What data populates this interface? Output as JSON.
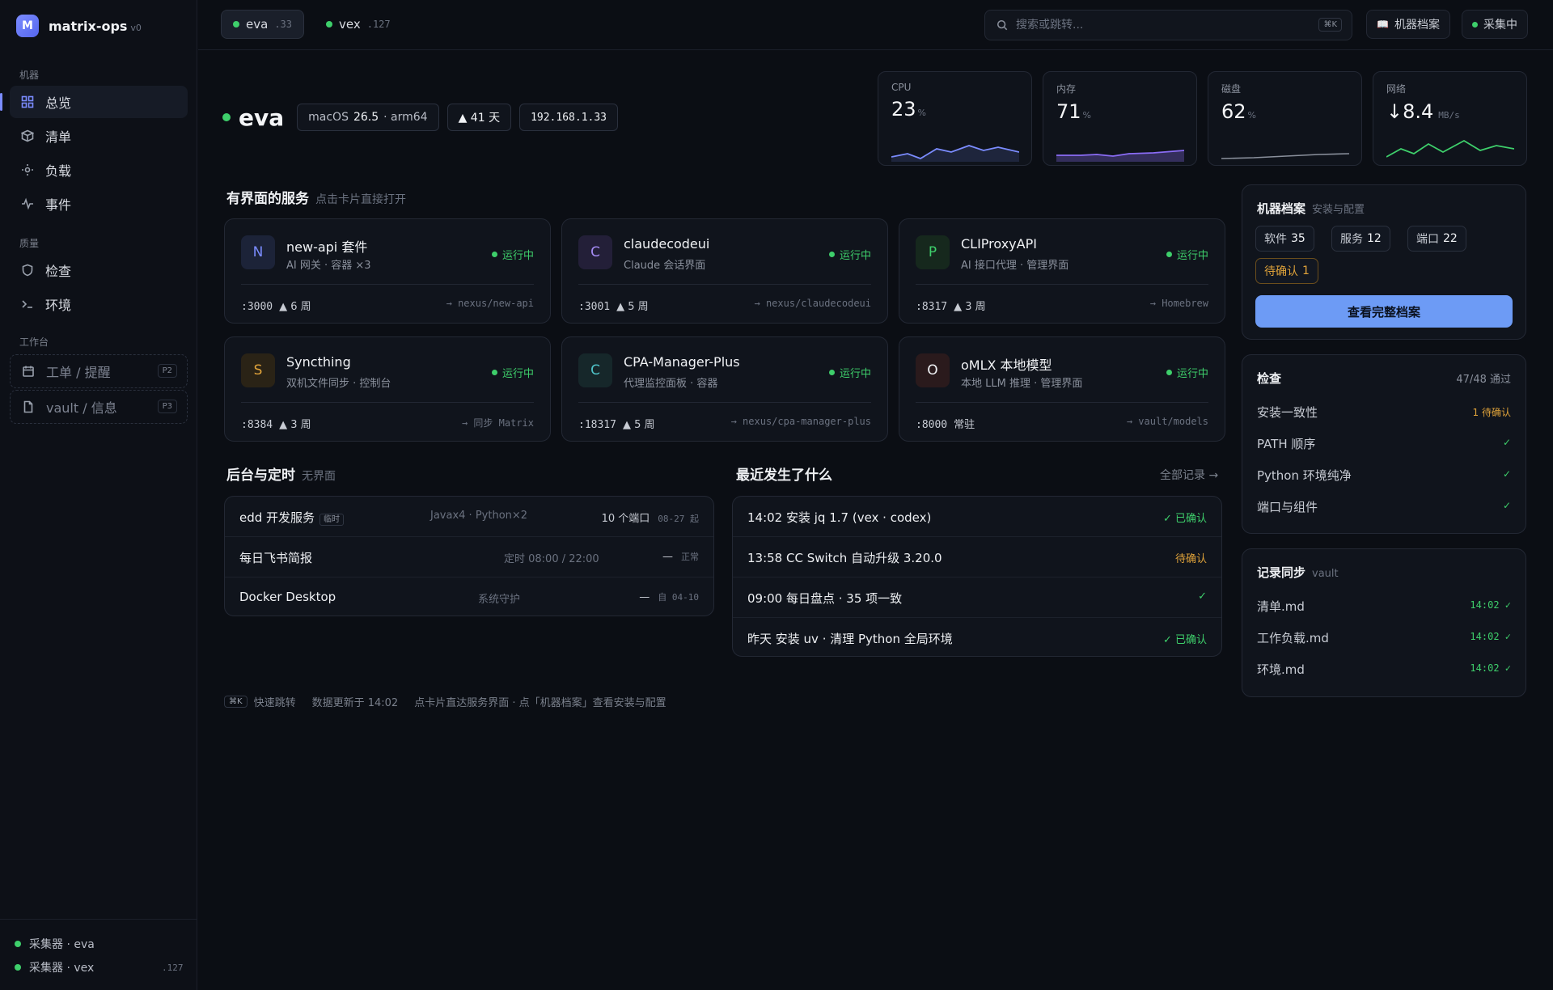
{
  "brand": {
    "name": "matrix-ops",
    "version": "v0",
    "logo": "M"
  },
  "sidebar": {
    "sections": [
      "机器",
      "质量",
      "工作台"
    ],
    "items": [
      {
        "label": "总览",
        "icon": "grid-icon"
      },
      {
        "label": "清单",
        "icon": "box-icon"
      },
      {
        "label": "负载",
        "icon": "sun-icon"
      },
      {
        "label": "事件",
        "icon": "pulse-icon"
      },
      {
        "label": "检查",
        "icon": "shield-icon"
      },
      {
        "label": "环境",
        "icon": "terminal-icon"
      }
    ],
    "workbench": [
      {
        "label": "工单 / 提醒",
        "badge": "P2"
      },
      {
        "label": "vault / 信息",
        "badge": "P3"
      }
    ],
    "collectors": [
      {
        "label": "采集器 · eva",
        "ip": ""
      },
      {
        "label": "采集器 · vex",
        "ip": ".127"
      }
    ]
  },
  "topbar": {
    "hosts": [
      {
        "name": "eva",
        "num": ".33"
      },
      {
        "name": "vex",
        "num": ".127"
      }
    ],
    "search_placeholder": "搜索或跳转...",
    "search_kbd": "⌘K",
    "profile_btn": "机器档案",
    "collect_btn": "采集中"
  },
  "host": {
    "name": "eva",
    "os": "macOS",
    "os_version": "26.5",
    "arch": "· arm64",
    "uptime": "▲ 41 天",
    "ip": "192.168.1.33"
  },
  "metrics": [
    {
      "label": "CPU",
      "value": "23",
      "unit": "%",
      "color": "#7b8cff"
    },
    {
      "label": "内存",
      "value": "71",
      "unit": "%",
      "color": "#8a6cf5"
    },
    {
      "label": "磁盘",
      "value": "62",
      "unit": "%",
      "color": "#9aa1ad"
    },
    {
      "label": "网络",
      "value": "↓8.4",
      "unit": "MB/s",
      "color": "#3ecf6b"
    }
  ],
  "services_section": {
    "title": "有界面的服务",
    "subtitle": "点击卡片直接打开"
  },
  "services": [
    {
      "initial": "N",
      "name": "new-api 套件",
      "desc": "AI 网关 · 容器 ×3",
      "status": "运行中",
      "port": ":3000",
      "age": "▲ 6 周",
      "path": "→ nexus/new-api",
      "color": "#7b8cff",
      "bg": "#1c2338"
    },
    {
      "initial": "C",
      "name": "claudecodeui",
      "desc": "Claude 会话界面",
      "status": "运行中",
      "port": ":3001",
      "age": "▲ 5 周",
      "path": "→ nexus/claudecodeui",
      "color": "#a58cf5",
      "bg": "#231f38"
    },
    {
      "initial": "P",
      "name": "CLIProxyAPI",
      "desc": "AI 接口代理 · 管理界面",
      "status": "运行中",
      "port": ":8317",
      "age": "▲ 3 周",
      "path": "→ Homebrew",
      "color": "#3ecf6b",
      "bg": "#16281d"
    },
    {
      "initial": "S",
      "name": "Syncthing",
      "desc": "双机文件同步 · 控制台",
      "status": "运行中",
      "port": ":8384",
      "age": "▲ 3 周",
      "path": "→ 同步 Matrix",
      "color": "#e0a33a",
      "bg": "#2a2316"
    },
    {
      "initial": "C",
      "name": "CPA-Manager-Plus",
      "desc": "代理监控面板 · 容器",
      "status": "运行中",
      "port": ":18317",
      "age": "▲ 5 周",
      "path": "→ nexus/cpa-manager-plus",
      "color": "#4fc3c8",
      "bg": "#16272a"
    },
    {
      "initial": "O",
      "name": "oMLX 本地模型",
      "desc": "本地 LLM 推理 · 管理界面",
      "status": "运行中",
      "port": ":8000",
      "age": "常驻",
      "path": "→ vault/models",
      "color": "#f0f2f5",
      "bg": "#2a1a1c"
    }
  ],
  "background": {
    "title": "后台与定时",
    "subtitle": "无界面",
    "rows": [
      {
        "name": "edd 开发服务",
        "tag": "临时",
        "meta": "Javax4 · Python×2",
        "right": "10 个端口",
        "right_sub": "08-27 起"
      },
      {
        "name": "每日飞书简报",
        "tag": "",
        "meta": "定时 08:00 / 22:00",
        "right": "—",
        "right_sub": "正常"
      },
      {
        "name": "Docker Desktop",
        "tag": "",
        "meta": "系统守护",
        "right": "—",
        "right_sub": "自 04-10"
      }
    ]
  },
  "events": {
    "title": "最近发生了什么",
    "all_link": "全部记录 →",
    "rows": [
      {
        "text": "14:02 安装 jq 1.7 (vex · codex)",
        "status": "✓ 已确认",
        "warn": false
      },
      {
        "text": "13:58 CC Switch 自动升级 3.20.0",
        "status": "待确认",
        "warn": true
      },
      {
        "text": "09:00 每日盘点 · 35 项一致",
        "status": "✓",
        "warn": false
      },
      {
        "text": "昨天 安装 uv · 清理 Python 全局环境",
        "status": "✓ 已确认",
        "warn": false
      }
    ]
  },
  "profile": {
    "title": "机器档案",
    "subtitle": "安装与配置",
    "chips": [
      {
        "label": "软件",
        "value": "35"
      },
      {
        "label": "服务",
        "value": "12"
      },
      {
        "label": "端口",
        "value": "22"
      }
    ],
    "pending": {
      "label": "待确认",
      "value": "1"
    },
    "button": "查看完整档案"
  },
  "checks": {
    "title": "检查",
    "summary": "47/48 通过",
    "rows": [
      {
        "label": "安装一致性",
        "value": "1 待确认",
        "warn": true
      },
      {
        "label": "PATH 顺序",
        "value": "✓",
        "warn": false
      },
      {
        "label": "Python 环境纯净",
        "value": "✓",
        "warn": false
      },
      {
        "label": "端口与组件",
        "value": "✓",
        "warn": false
      }
    ]
  },
  "sync": {
    "title": "记录同步",
    "subtitle": "vault",
    "rows": [
      {
        "label": "清单.md",
        "value": "14:02 ✓"
      },
      {
        "label": "工作负载.md",
        "value": "14:02 ✓"
      },
      {
        "label": "环境.md",
        "value": "14:02 ✓"
      }
    ]
  },
  "footer": {
    "kbd": "⌘K",
    "jump": "快速跳转",
    "updated": "数据更新于 14:02",
    "hint": "点卡片直达服务界面 · 点「机器档案」查看安装与配置"
  }
}
